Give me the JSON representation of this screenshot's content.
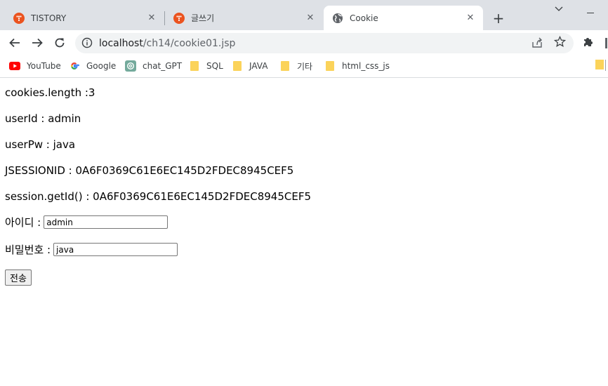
{
  "browser": {
    "tabs": [
      {
        "title": "TISTORY",
        "active": false
      },
      {
        "title": "글쓰기",
        "active": false
      },
      {
        "title": "Cookie",
        "active": true
      }
    ],
    "new_tab": "+",
    "close_glyph": "✕",
    "url_host": "localhost",
    "url_path": "/ch14/cookie01.jsp",
    "bookmarks": [
      {
        "label": "YouTube",
        "icon": "youtube-icon"
      },
      {
        "label": "Google",
        "icon": "google-icon"
      },
      {
        "label": "chat_GPT",
        "icon": "chatgpt-icon"
      },
      {
        "label": "SQL",
        "icon": "folder-icon"
      },
      {
        "label": "JAVA",
        "icon": "folder-icon"
      },
      {
        "label": "기타",
        "icon": "folder-icon"
      },
      {
        "label": "html_css_js",
        "icon": "folder-icon"
      }
    ],
    "colors": {
      "tab_strip": "#dee1e6",
      "omnibox": "#f1f3f4",
      "tistory_red": "#eb531f",
      "folder": "#fbd35a"
    }
  },
  "page": {
    "lines": [
      "cookies.length :3",
      "userId : admin",
      "userPw : java",
      "JSESSIONID : 0A6F0369C61E6EC145D2FDEC8945CEF5",
      "session.getId() : 0A6F0369C61E6EC145D2FDEC8945CEF5"
    ],
    "form": {
      "id_label": "아이디 : ",
      "id_value": "admin",
      "pw_label": "비밀번호 : ",
      "pw_value": "java",
      "submit_label": "전송"
    }
  }
}
